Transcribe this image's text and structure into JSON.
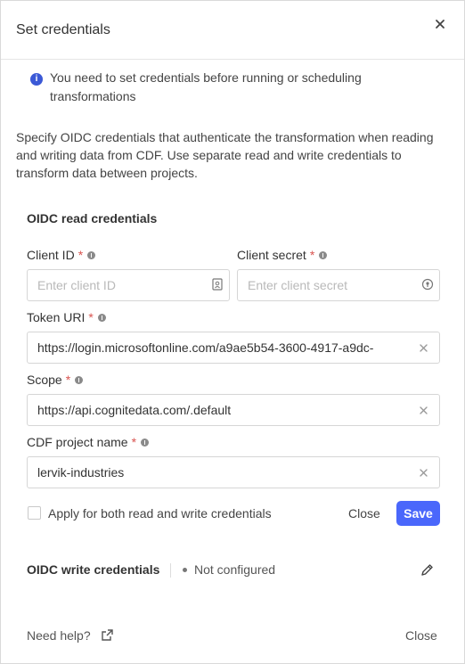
{
  "dialog": {
    "title": "Set credentials"
  },
  "info": {
    "message": "You need to set credentials before running or scheduling transformations"
  },
  "description": "Specify OIDC credentials that authenticate the transformation when reading and writing data from CDF. Use separate read and write credentials to transform data between projects.",
  "read": {
    "section_title": "OIDC read credentials",
    "client_id": {
      "label": "Client ID",
      "required": "*",
      "placeholder": "Enter client ID",
      "value": ""
    },
    "client_secret": {
      "label": "Client secret",
      "required": "*",
      "placeholder": "Enter client secret",
      "value": ""
    },
    "token_uri": {
      "label": "Token URI",
      "required": "*",
      "value": "https://login.microsoftonline.com/a9ae5b54-3600-4917-a9dc-"
    },
    "scope": {
      "label": "Scope",
      "required": "*",
      "value": "https://api.cognitedata.com/.default"
    },
    "cdf_project": {
      "label": "CDF project name",
      "required": "*",
      "value": "lervik-industries"
    },
    "apply_both_label": "Apply for both read and write credentials",
    "close_label": "Close",
    "save_label": "Save"
  },
  "write": {
    "section_title": "OIDC write credentials",
    "status": "Not configured"
  },
  "footer": {
    "help_label": "Need help?",
    "close_label": "Close"
  },
  "colors": {
    "accent": "#4a67fb",
    "info": "#3b59d6",
    "required": "#d9534f"
  },
  "icons": [
    "close-icon",
    "info-icon",
    "help-hint-icon",
    "contact-card-icon",
    "key-icon",
    "clear-icon",
    "edit-pencil-icon",
    "external-link-icon"
  ]
}
